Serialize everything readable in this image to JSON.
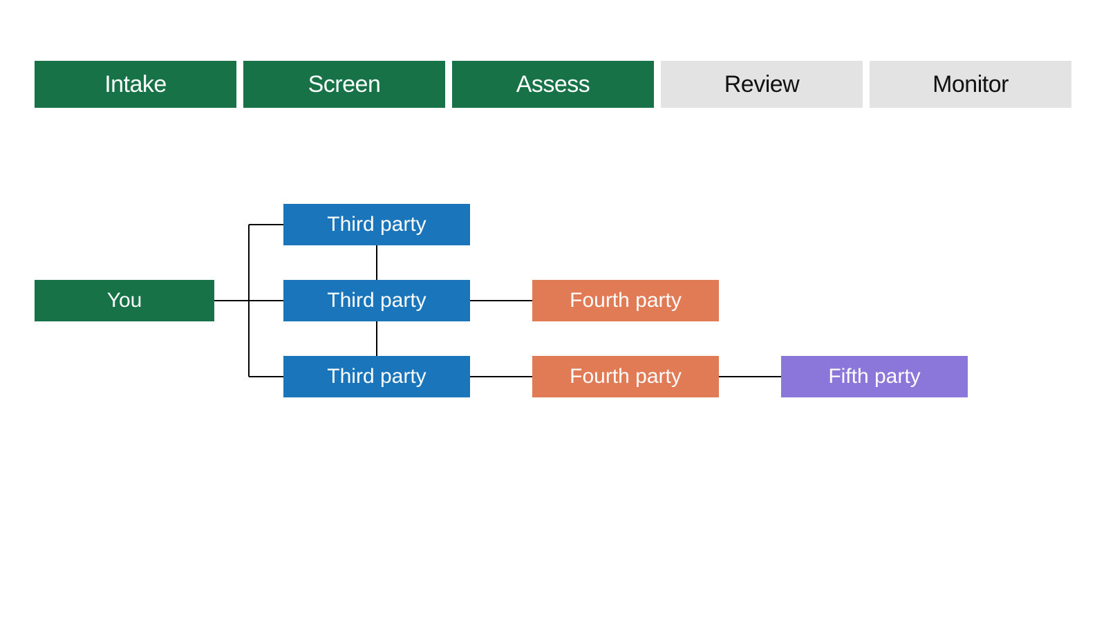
{
  "stages": [
    {
      "label": "Intake",
      "state": "active"
    },
    {
      "label": "Screen",
      "state": "active"
    },
    {
      "label": "Assess",
      "state": "active"
    },
    {
      "label": "Review",
      "state": "inactive"
    },
    {
      "label": "Monitor",
      "state": "inactive"
    }
  ],
  "diagram": {
    "you_label": "You",
    "third_party_label": "Third party",
    "fourth_party_label": "Fourth party",
    "fifth_party_label": "Fifth party",
    "colors": {
      "you": "#177347",
      "third": "#1B75BB",
      "fourth": "#E07B56",
      "fifth": "#8A77D9",
      "stage_active_bg": "#177347",
      "stage_inactive_bg": "#e3e3e3"
    },
    "structure": {
      "root": "you",
      "children": [
        {
          "type": "third"
        },
        {
          "type": "third",
          "children": [
            {
              "type": "fourth"
            }
          ]
        },
        {
          "type": "third",
          "children": [
            {
              "type": "fourth",
              "children": [
                {
                  "type": "fifth"
                }
              ]
            }
          ]
        }
      ]
    }
  }
}
